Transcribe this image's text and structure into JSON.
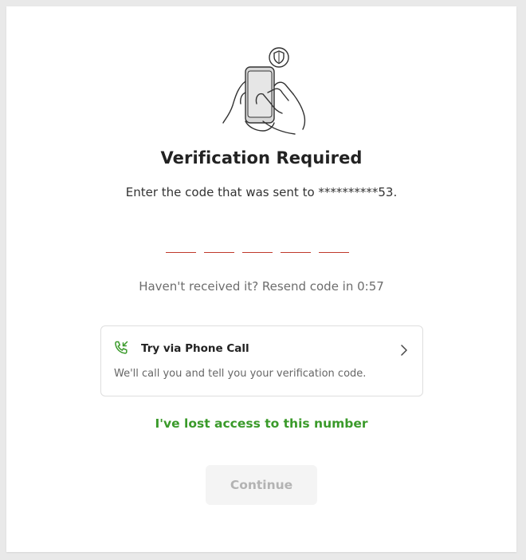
{
  "header": {
    "title": "Verification Required",
    "subtitle": "Enter the code that was sent to **********53."
  },
  "code_input": {
    "digits": [
      "",
      "",
      "",
      "",
      ""
    ]
  },
  "resend": {
    "text": "Haven't received it? Resend code in 0:57"
  },
  "phone_call_option": {
    "title": "Try via Phone Call",
    "description": "We'll call you and tell you your verification code."
  },
  "lost_access": {
    "label": "I've lost access to this number"
  },
  "continue_button": {
    "label": "Continue"
  },
  "colors": {
    "accent_green": "#3a9a2a",
    "code_underline": "#c0392b",
    "disabled_bg": "#f4f4f4",
    "disabled_text": "#b3b3b3"
  }
}
